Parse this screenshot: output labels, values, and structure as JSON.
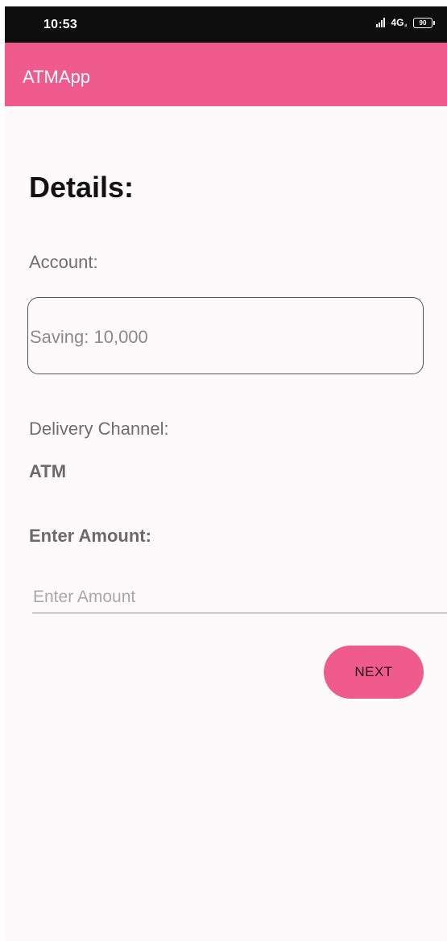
{
  "status_bar": {
    "time": "10:53",
    "network": "4G",
    "network_sup": "ᵢₗ",
    "battery": "90"
  },
  "app_bar": {
    "title": "ATMApp",
    "color": "#ef5b8c"
  },
  "details": {
    "heading": "Details:",
    "account_label": "Account:",
    "account_value": "Saving: 10,000",
    "delivery_label": "Delivery Channel:",
    "delivery_value": "ATM",
    "amount_label": "Enter Amount:",
    "amount_placeholder": "Enter Amount",
    "amount_value": ""
  },
  "actions": {
    "next_label": "NEXT"
  }
}
